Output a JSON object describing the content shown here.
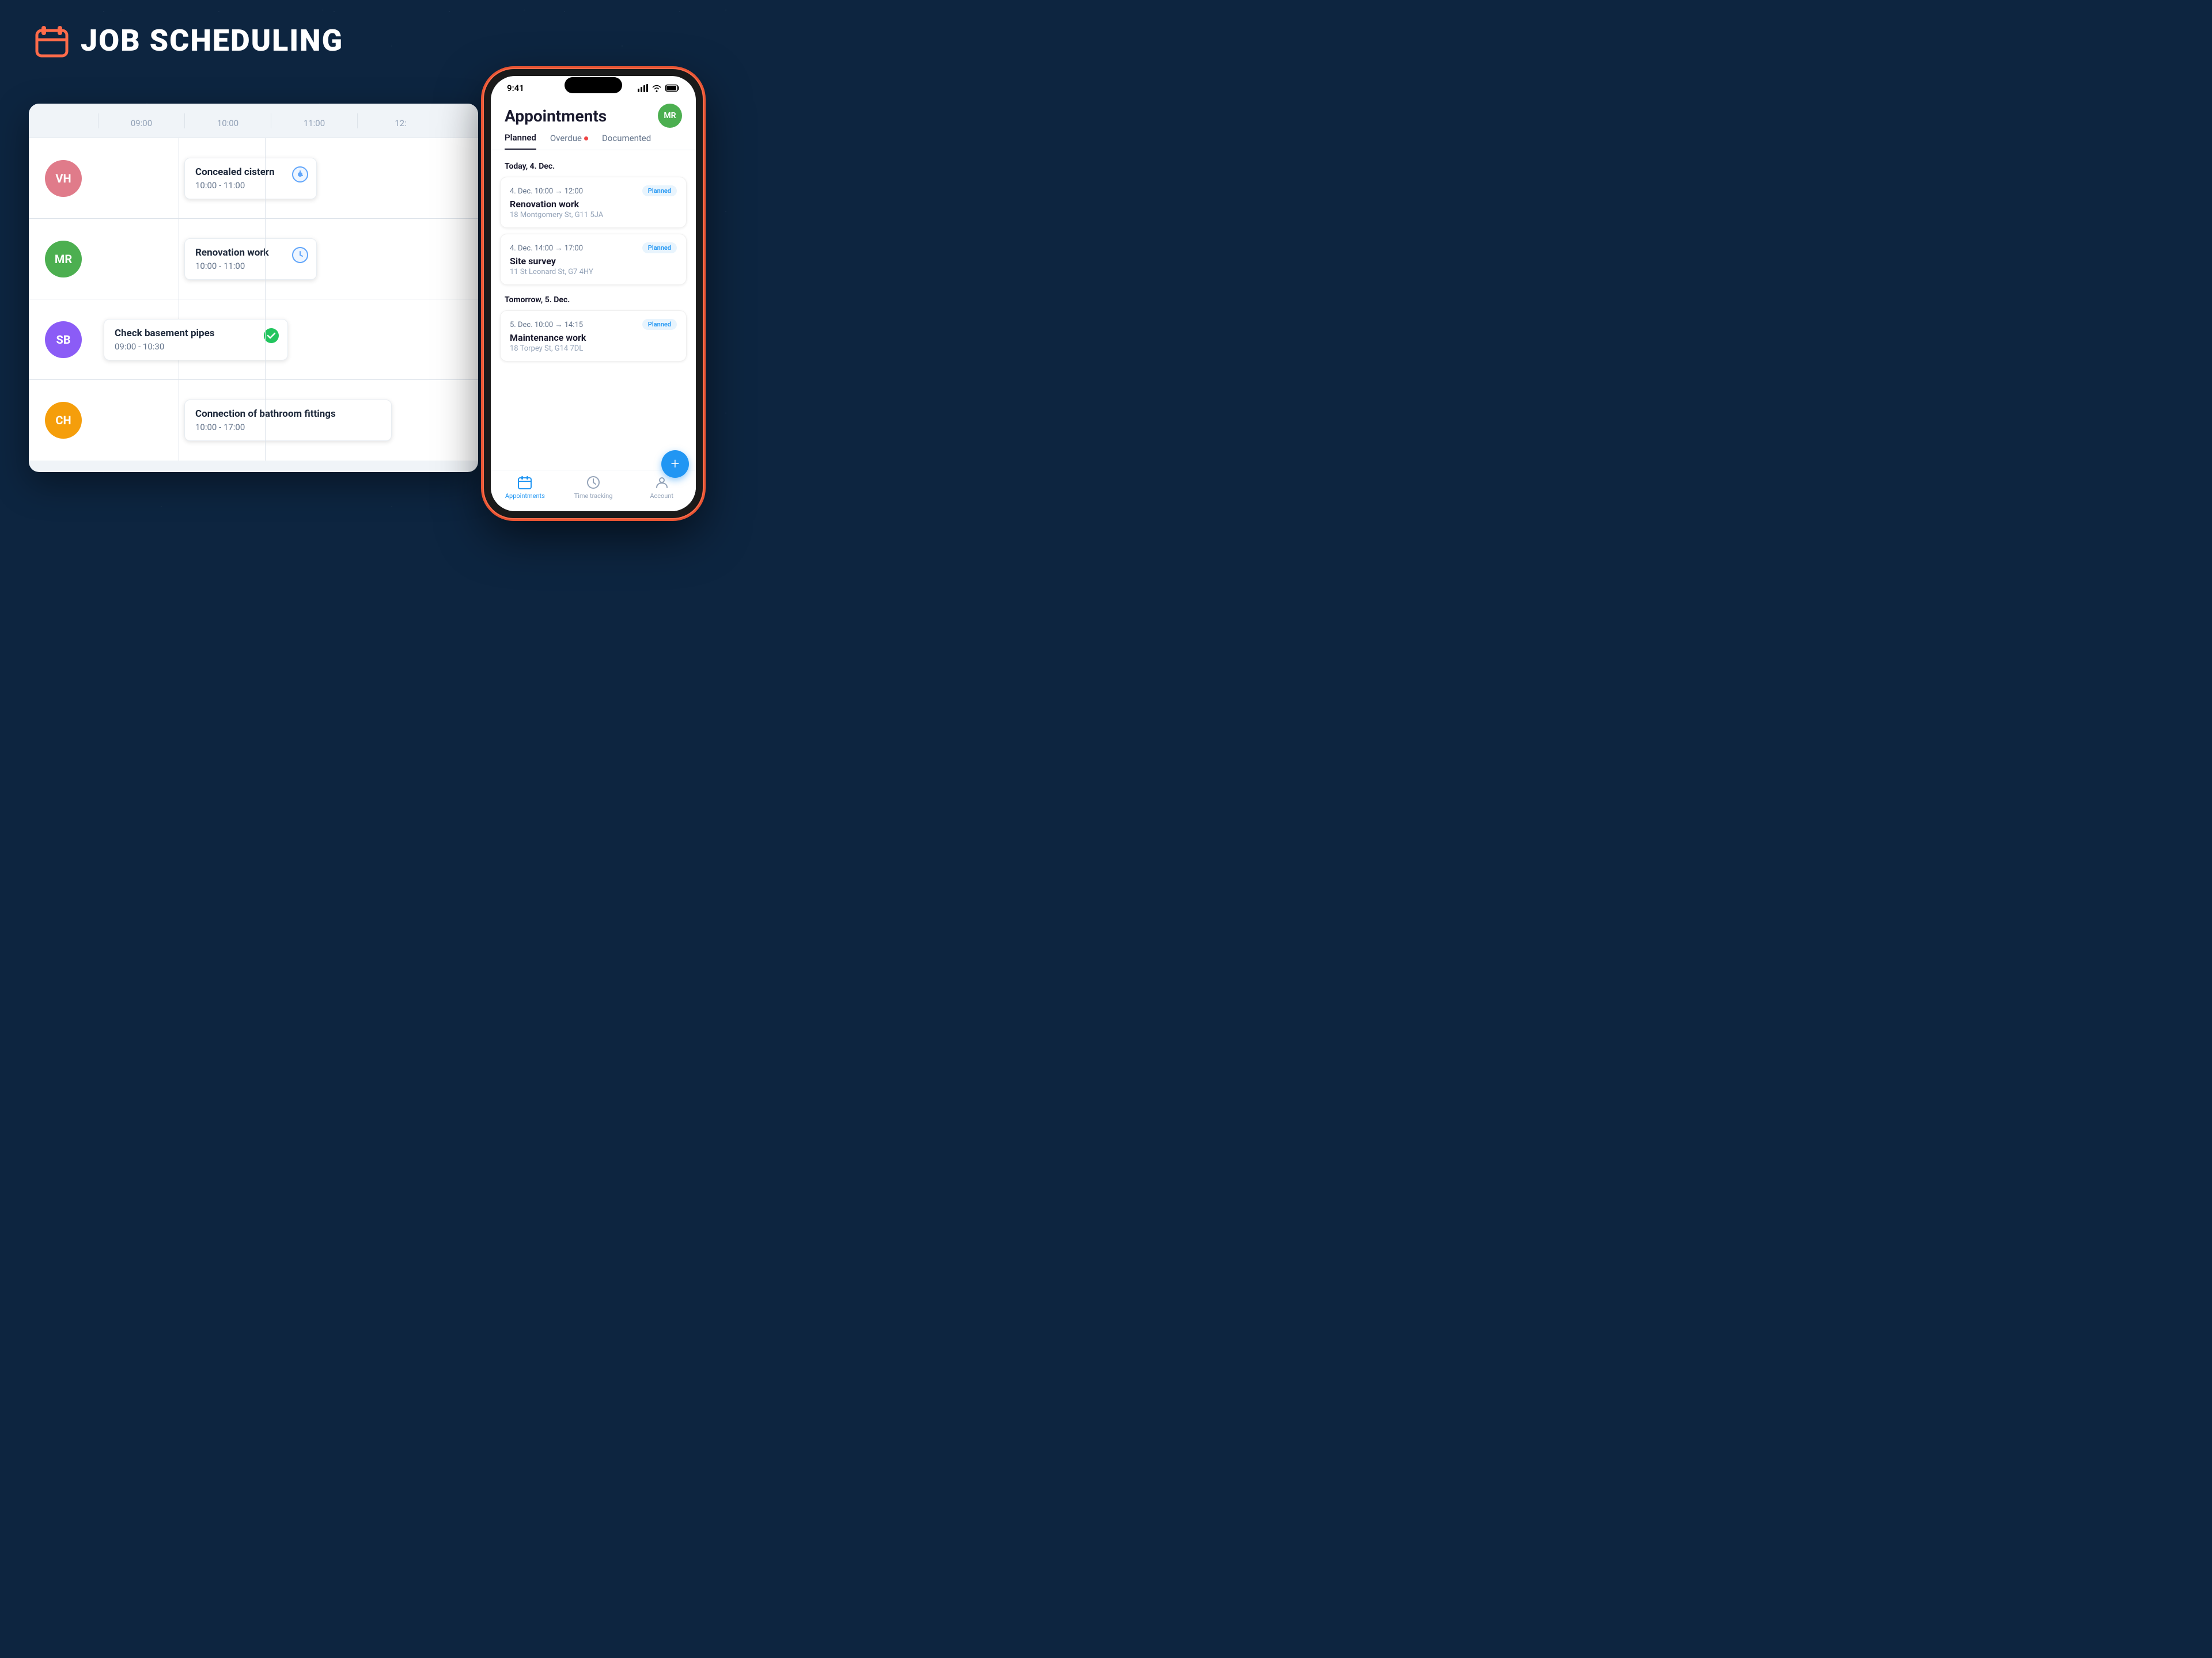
{
  "header": {
    "title": "JOB SCHEDULING",
    "icon_label": "calendar-icon"
  },
  "calendar": {
    "time_labels": [
      "09:00",
      "10:00",
      "11:00",
      "12:"
    ],
    "rows": [
      {
        "avatar": "VH",
        "avatar_color": "#e07b8a",
        "event_title": "Concealed cistern",
        "event_time": "10:00 - 11:00",
        "icon_type": "clock",
        "offset": "10"
      },
      {
        "avatar": "MR",
        "avatar_color": "#4CAF50",
        "event_title": "Renovation work",
        "event_time": "10:00 - 11:00",
        "icon_type": "clock",
        "offset": "10"
      },
      {
        "avatar": "SB",
        "avatar_color": "#8b5cf6",
        "event_title": "Check basement pipes",
        "event_time": "09:00 - 10:30",
        "icon_type": "check",
        "offset": "09"
      },
      {
        "avatar": "CH",
        "avatar_color": "#f59e0b",
        "event_title": "Connection of bathroom fittings",
        "event_time": "10:00 - 17:00",
        "icon_type": "none",
        "offset": "10"
      }
    ]
  },
  "phone": {
    "status_time": "9:41",
    "app_title": "Appointments",
    "user_avatar": "MR",
    "tabs": [
      {
        "label": "Planned",
        "active": true,
        "dot": false
      },
      {
        "label": "Overdue",
        "active": false,
        "dot": true
      },
      {
        "label": "Documented",
        "active": false,
        "dot": false
      }
    ],
    "sections": [
      {
        "label": "Today, 4. Dec.",
        "appointments": [
          {
            "time_start": "4. Dec. 10:00",
            "time_end": "12:00",
            "badge": "Planned",
            "title": "Renovation work",
            "address": "18 Montgomery St, G11 5JA"
          },
          {
            "time_start": "4. Dec. 14:00",
            "time_end": "17:00",
            "badge": "Planned",
            "title": "Site survey",
            "address": "11 St Leonard St, G7 4HY"
          }
        ]
      },
      {
        "label": "Tomorrow, 5. Dec.",
        "appointments": [
          {
            "time_start": "5. Dec. 10:00",
            "time_end": "14:15",
            "badge": "Planned",
            "title": "Maintenance work",
            "address": "18 Torpey St, G14 7DL"
          }
        ]
      }
    ],
    "nav_items": [
      {
        "label": "Appointments",
        "active": true,
        "icon": "calendar"
      },
      {
        "label": "Time tracking",
        "active": false,
        "icon": "clock"
      },
      {
        "label": "Account",
        "active": false,
        "icon": "person"
      }
    ],
    "fab_label": "+"
  }
}
